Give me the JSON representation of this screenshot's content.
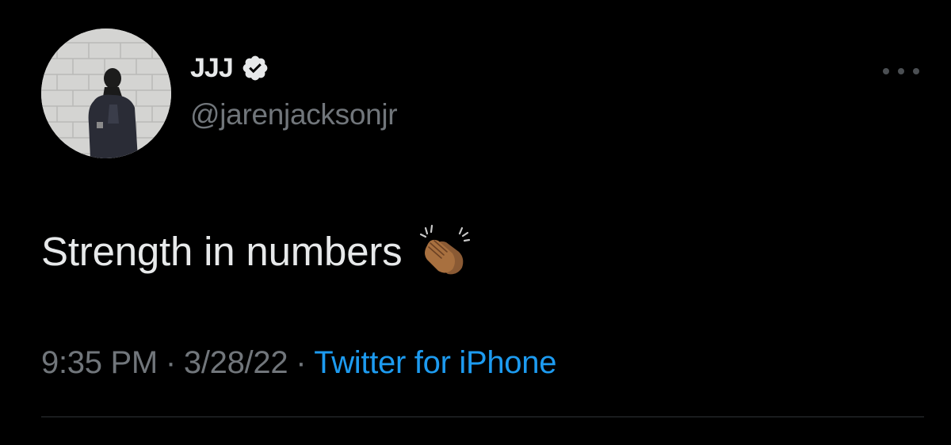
{
  "tweet": {
    "display_name": "JJJ",
    "handle": "@jarenjacksonjr",
    "verified": true,
    "text": "Strength in numbers",
    "emoji_icon": "clapping-hands-icon",
    "time": "9:35 PM",
    "date": "3/28/22",
    "separator": "·",
    "source": "Twitter for iPhone"
  },
  "colors": {
    "background": "#000000",
    "primary_text": "#e7e9ea",
    "secondary_text": "#71767b",
    "link": "#1d9bf0",
    "verified_badge": "#e7e9ea"
  },
  "icons": {
    "verified": "verified-badge-icon",
    "more": "more-options-icon",
    "avatar": "profile-avatar"
  }
}
